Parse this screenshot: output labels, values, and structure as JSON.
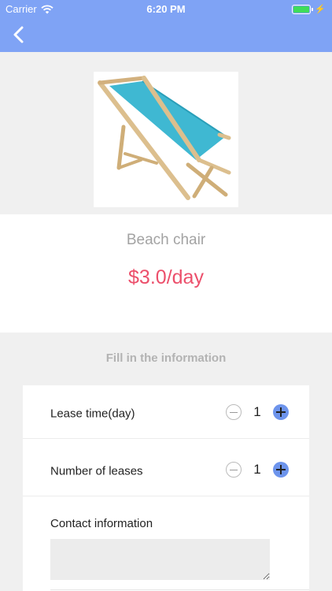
{
  "status_bar": {
    "carrier": "Carrier",
    "time": "6:20 PM"
  },
  "product": {
    "name": "Beach chair",
    "price": "$3.0/day"
  },
  "form": {
    "section_title": "Fill in the information",
    "lease_time": {
      "label": "Lease time(day)",
      "value": "1"
    },
    "number_of_leases": {
      "label": "Number of leases",
      "value": "1"
    },
    "contact": {
      "label": "Contact information",
      "value": ""
    }
  },
  "colors": {
    "nav_background": "#7fa3f5",
    "price": "#ec4f6b",
    "stepper_plus": "#6d94ec",
    "chair_fabric": "#3fb8d2",
    "chair_wood": "#dcbf8e"
  },
  "icons": [
    "wifi-icon",
    "battery-icon",
    "charging-icon",
    "back-arrow-icon",
    "minus-icon",
    "plus-icon"
  ]
}
